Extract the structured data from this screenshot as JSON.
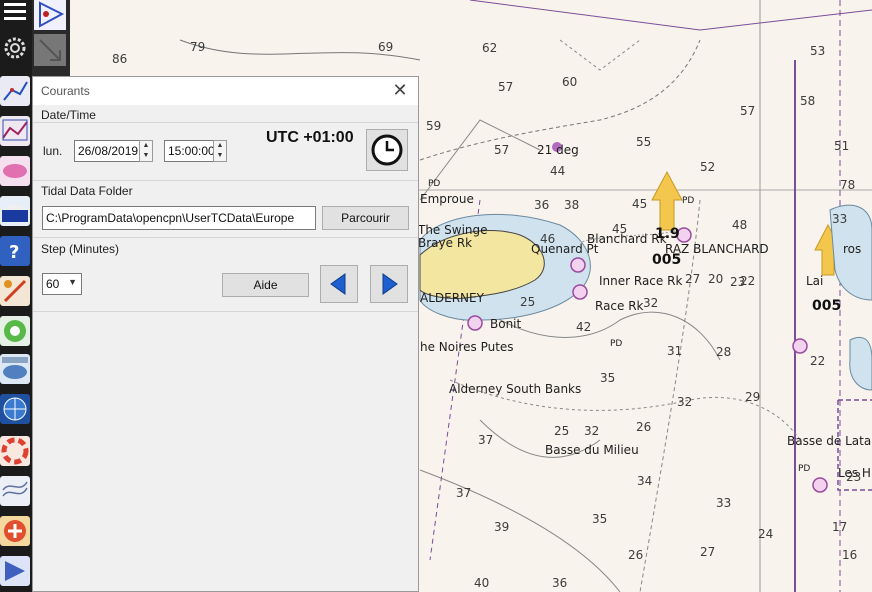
{
  "dialog": {
    "title": "Courants",
    "datetime_section": "Date/Time",
    "day_label": "lun.",
    "date_value": "26/08/2019",
    "time_value": "15:00:00",
    "utc_offset": "UTC +01:00",
    "tidal_section": "Tidal Data Folder",
    "folder_path": "C:\\ProgramData\\opencpn\\UserTCData\\Europe",
    "browse_button": "Parcourir",
    "step_section": "Step (Minutes)",
    "step_value": "60",
    "help_button": "Aide",
    "close_glyph": "✕"
  },
  "chart": {
    "depths": [
      "79",
      "86",
      "69",
      "62",
      "57",
      "60",
      "53",
      "58",
      "57",
      "55",
      "59",
      "57",
      "52",
      "51",
      "78",
      "44",
      "38",
      "45",
      "48",
      "22",
      "33",
      "36",
      "27",
      "20",
      "23",
      "28",
      "25",
      "42",
      "32",
      "31",
      "35",
      "32",
      "17",
      "37",
      "26",
      "29",
      "25",
      "32",
      "37",
      "39",
      "34",
      "35",
      "33",
      "27",
      "26",
      "24",
      "16",
      "40",
      "36",
      "22",
      "45",
      "46",
      "23"
    ],
    "places": [
      "Emproue",
      "The Swinge",
      "Braye Rk",
      "Quenard Pt",
      "Blanchard Rk",
      "RAZ BLANCHARD",
      "Inner Race Rk",
      "Race Rk",
      "ALDERNEY",
      "Bonit",
      "he Noires Putes",
      "Alderney South Banks",
      "Basse du Milieu",
      "Basse de Lata",
      "Les H",
      "ros",
      "Lai",
      "21 deg",
      "PD",
      "PD",
      "PD",
      "PD"
    ],
    "tide_labels": [
      "1.9",
      "005",
      "005"
    ]
  },
  "colors": {
    "chart_bg": "#f8f3ec",
    "land": "#f2e6a0",
    "shallow": "#cfe2ee",
    "lines": "#6a6a6a",
    "purple": "#8a5aa8",
    "tide_arrow": "#f3c64d"
  },
  "icons": [
    "menu-icon",
    "route-icon",
    "settings-icon",
    "measure-icon",
    "track-icon",
    "layer-icon",
    "help-icon",
    "ais-icon",
    "tools-icon",
    "gps-icon",
    "grib-icon",
    "clock-icon",
    "arrow-left-icon",
    "arrow-right-icon"
  ]
}
